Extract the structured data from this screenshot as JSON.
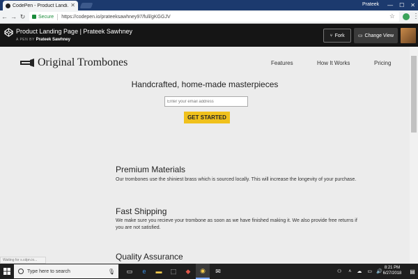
{
  "browser": {
    "tab_title": "CodePen - Product Landi...",
    "profile_name": "Prateek",
    "secure_label": "Secure",
    "url": "https://codepen.io/prateeksawhney97/full/gKGGJV"
  },
  "codepen": {
    "title": "Product Landing Page | Prateek Sawhney",
    "pen_by_label": "A PEN BY",
    "author": "Prateek Sawhney",
    "fork_label": "Fork",
    "change_view_label": "Change View"
  },
  "page": {
    "brand": "Original Trombones",
    "nav": [
      "Features",
      "How It Works",
      "Pricing"
    ],
    "headline": "Handcrafted, home-made masterpieces",
    "email_placeholder": "Enter your email address",
    "cta_label": "GET STARTED",
    "features": [
      {
        "title": "Premium Materials",
        "desc": "Our trombones use the shiniest brass which is sourced locally. This will increase the longevity of your purchase."
      },
      {
        "title": "Fast Shipping",
        "desc": "We make sure you recieve your trombone as soon as we have finished making it. We also provide free returns if you are not satisfied."
      },
      {
        "title": "Quality Assurance",
        "desc": ""
      }
    ]
  },
  "status_text": "Waiting for s.cdpn.io...",
  "taskbar": {
    "search_placeholder": "Type here to search",
    "time": "8:21 PM",
    "date": "6/27/2018"
  },
  "colors": {
    "cta": "#f0c11c",
    "codepen_header": "#151515",
    "page_bg": "#ececec",
    "tab_strip": "#1c3a6e"
  }
}
